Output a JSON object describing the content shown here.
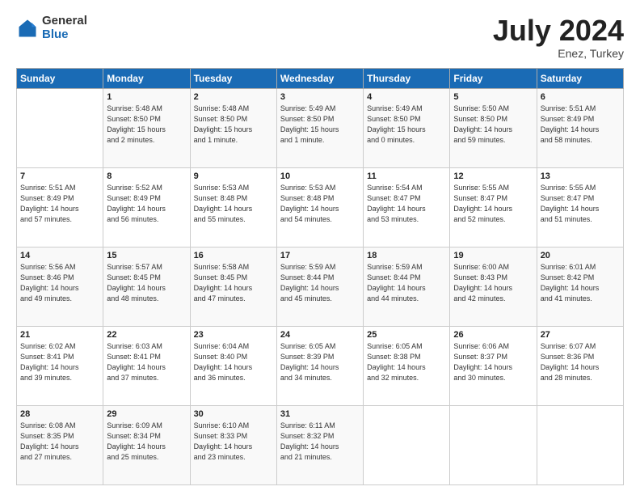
{
  "header": {
    "logo_general": "General",
    "logo_blue": "Blue",
    "month": "July 2024",
    "location": "Enez, Turkey"
  },
  "weekdays": [
    "Sunday",
    "Monday",
    "Tuesday",
    "Wednesday",
    "Thursday",
    "Friday",
    "Saturday"
  ],
  "weeks": [
    [
      {
        "day": "",
        "info": ""
      },
      {
        "day": "1",
        "info": "Sunrise: 5:48 AM\nSunset: 8:50 PM\nDaylight: 15 hours\nand 2 minutes."
      },
      {
        "day": "2",
        "info": "Sunrise: 5:48 AM\nSunset: 8:50 PM\nDaylight: 15 hours\nand 1 minute."
      },
      {
        "day": "3",
        "info": "Sunrise: 5:49 AM\nSunset: 8:50 PM\nDaylight: 15 hours\nand 1 minute."
      },
      {
        "day": "4",
        "info": "Sunrise: 5:49 AM\nSunset: 8:50 PM\nDaylight: 15 hours\nand 0 minutes."
      },
      {
        "day": "5",
        "info": "Sunrise: 5:50 AM\nSunset: 8:50 PM\nDaylight: 14 hours\nand 59 minutes."
      },
      {
        "day": "6",
        "info": "Sunrise: 5:51 AM\nSunset: 8:49 PM\nDaylight: 14 hours\nand 58 minutes."
      }
    ],
    [
      {
        "day": "7",
        "info": "Sunrise: 5:51 AM\nSunset: 8:49 PM\nDaylight: 14 hours\nand 57 minutes."
      },
      {
        "day": "8",
        "info": "Sunrise: 5:52 AM\nSunset: 8:49 PM\nDaylight: 14 hours\nand 56 minutes."
      },
      {
        "day": "9",
        "info": "Sunrise: 5:53 AM\nSunset: 8:48 PM\nDaylight: 14 hours\nand 55 minutes."
      },
      {
        "day": "10",
        "info": "Sunrise: 5:53 AM\nSunset: 8:48 PM\nDaylight: 14 hours\nand 54 minutes."
      },
      {
        "day": "11",
        "info": "Sunrise: 5:54 AM\nSunset: 8:47 PM\nDaylight: 14 hours\nand 53 minutes."
      },
      {
        "day": "12",
        "info": "Sunrise: 5:55 AM\nSunset: 8:47 PM\nDaylight: 14 hours\nand 52 minutes."
      },
      {
        "day": "13",
        "info": "Sunrise: 5:55 AM\nSunset: 8:47 PM\nDaylight: 14 hours\nand 51 minutes."
      }
    ],
    [
      {
        "day": "14",
        "info": "Sunrise: 5:56 AM\nSunset: 8:46 PM\nDaylight: 14 hours\nand 49 minutes."
      },
      {
        "day": "15",
        "info": "Sunrise: 5:57 AM\nSunset: 8:45 PM\nDaylight: 14 hours\nand 48 minutes."
      },
      {
        "day": "16",
        "info": "Sunrise: 5:58 AM\nSunset: 8:45 PM\nDaylight: 14 hours\nand 47 minutes."
      },
      {
        "day": "17",
        "info": "Sunrise: 5:59 AM\nSunset: 8:44 PM\nDaylight: 14 hours\nand 45 minutes."
      },
      {
        "day": "18",
        "info": "Sunrise: 5:59 AM\nSunset: 8:44 PM\nDaylight: 14 hours\nand 44 minutes."
      },
      {
        "day": "19",
        "info": "Sunrise: 6:00 AM\nSunset: 8:43 PM\nDaylight: 14 hours\nand 42 minutes."
      },
      {
        "day": "20",
        "info": "Sunrise: 6:01 AM\nSunset: 8:42 PM\nDaylight: 14 hours\nand 41 minutes."
      }
    ],
    [
      {
        "day": "21",
        "info": "Sunrise: 6:02 AM\nSunset: 8:41 PM\nDaylight: 14 hours\nand 39 minutes."
      },
      {
        "day": "22",
        "info": "Sunrise: 6:03 AM\nSunset: 8:41 PM\nDaylight: 14 hours\nand 37 minutes."
      },
      {
        "day": "23",
        "info": "Sunrise: 6:04 AM\nSunset: 8:40 PM\nDaylight: 14 hours\nand 36 minutes."
      },
      {
        "day": "24",
        "info": "Sunrise: 6:05 AM\nSunset: 8:39 PM\nDaylight: 14 hours\nand 34 minutes."
      },
      {
        "day": "25",
        "info": "Sunrise: 6:05 AM\nSunset: 8:38 PM\nDaylight: 14 hours\nand 32 minutes."
      },
      {
        "day": "26",
        "info": "Sunrise: 6:06 AM\nSunset: 8:37 PM\nDaylight: 14 hours\nand 30 minutes."
      },
      {
        "day": "27",
        "info": "Sunrise: 6:07 AM\nSunset: 8:36 PM\nDaylight: 14 hours\nand 28 minutes."
      }
    ],
    [
      {
        "day": "28",
        "info": "Sunrise: 6:08 AM\nSunset: 8:35 PM\nDaylight: 14 hours\nand 27 minutes."
      },
      {
        "day": "29",
        "info": "Sunrise: 6:09 AM\nSunset: 8:34 PM\nDaylight: 14 hours\nand 25 minutes."
      },
      {
        "day": "30",
        "info": "Sunrise: 6:10 AM\nSunset: 8:33 PM\nDaylight: 14 hours\nand 23 minutes."
      },
      {
        "day": "31",
        "info": "Sunrise: 6:11 AM\nSunset: 8:32 PM\nDaylight: 14 hours\nand 21 minutes."
      },
      {
        "day": "",
        "info": ""
      },
      {
        "day": "",
        "info": ""
      },
      {
        "day": "",
        "info": ""
      }
    ]
  ]
}
